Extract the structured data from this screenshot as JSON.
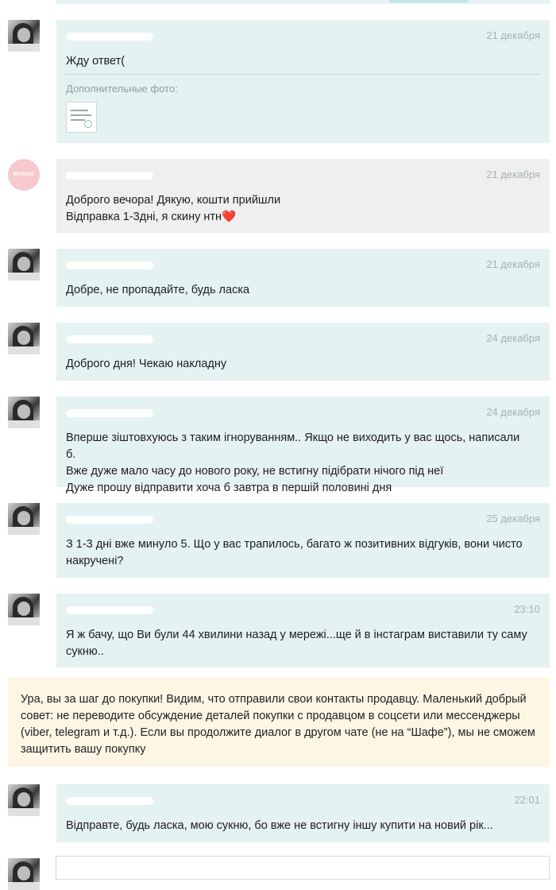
{
  "messages": [
    {
      "date": "21 декабря",
      "text": [
        "Жду ответ("
      ],
      "extra_label": "Дополнительные фото:"
    },
    {
      "date": "21 декабря",
      "text": [
        "Доброго вечора! Дякую, кошти прийшли",
        "Відправка 1-3дні, я скину нтн❤️"
      ],
      "avatar_text": "MARINE"
    },
    {
      "date": "21 декабря",
      "text": [
        "Добре, не пропадайте, будь ласка"
      ]
    },
    {
      "date": "24 декабря",
      "text": [
        "Доброго дня! Чекаю накладну"
      ]
    },
    {
      "date": "24 декабря",
      "text": [
        "Вперше зіштовхуюсь з таким ігноруванням.. Якщо не виходить у вас щось, написали б.",
        "Вже дуже мало часу до нового року, не встигну підібрати нічого під неї",
        "Дуже прошу відправити хоча б завтра в першій половині дня"
      ]
    },
    {
      "date": "25 декабря",
      "text": [
        "З 1-3 дні вже минуло 5. Що у вас трапилось, багато ж позитивних відгуків, вони чисто",
        "накручені?"
      ]
    },
    {
      "date": "23:10",
      "text": [
        "Я ж бачу, що Ви були 44 хвилини назад у мережі...ще й в інстаграм виставили ту саму",
        "сукню.."
      ]
    },
    {
      "date": "22:01",
      "text": [
        "Відправте, будь ласка, мою сукню, бо вже не встигну іншу купити на новий рік..."
      ]
    }
  ],
  "notice": {
    "lines": [
      "Ура, вы за шаг до покупки! Видим, что отправили свои контакты продавцу. Маленький добрый",
      "совет: не переводите обсуждение деталей покупки с продавцом в соцсети или мессенджеры",
      "(viber, telegram и т.д.). Если вы продолжите диалог в другом чате (не на “Шафе”), мы не сможем",
      "защитить вашу покупку"
    ]
  },
  "colors": {
    "bubble_buyer": "#e4f3f1",
    "bubble_seller": "#efefef",
    "notice_bg": "#fdf6e4",
    "date": "#a5b0af"
  }
}
